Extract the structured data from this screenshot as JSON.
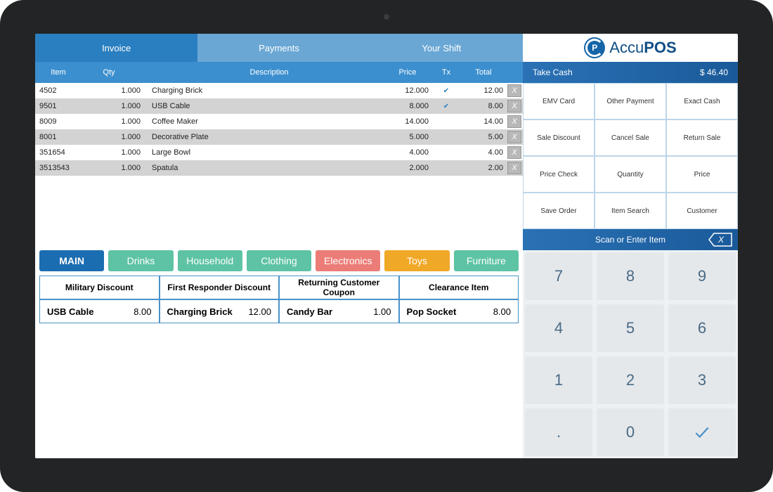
{
  "brand": {
    "logo_letter": "P",
    "name_light": "Accu",
    "name_bold": "POS"
  },
  "tabs": {
    "invoice": "Invoice",
    "payments": "Payments",
    "shift": "Your Shift"
  },
  "headers": {
    "item": "Item",
    "qty": "Qty",
    "desc": "Description",
    "price": "Price",
    "tx": "Tx",
    "total": "Total"
  },
  "rows": [
    {
      "item": "4502",
      "qty": "1.000",
      "desc": "Charging Brick",
      "price": "12.000",
      "tx": true,
      "total": "12.00"
    },
    {
      "item": "9501",
      "qty": "1.000",
      "desc": "USB Cable",
      "price": "8.000",
      "tx": true,
      "total": "8.00"
    },
    {
      "item": "8009",
      "qty": "1.000",
      "desc": "Coffee Maker",
      "price": "14.000",
      "tx": false,
      "total": "14.00"
    },
    {
      "item": "8001",
      "qty": "1.000",
      "desc": "Decorative Plate",
      "price": "5.000",
      "tx": false,
      "total": "5.00"
    },
    {
      "item": "351654",
      "qty": "1.000",
      "desc": "Large Bowl",
      "price": "4.000",
      "tx": false,
      "total": "4.00"
    },
    {
      "item": "3513543",
      "qty": "1.000",
      "desc": "Spatula",
      "price": "2.000",
      "tx": false,
      "total": "2.00"
    }
  ],
  "delete_glyph": "X",
  "categories": {
    "main": "MAIN",
    "c1": "Drinks",
    "c2": "Household",
    "c3": "Clothing",
    "c4": "Electronics",
    "c5": "Toys",
    "c6": "Furniture"
  },
  "discounts": [
    "Military Discount",
    "First Responder Discount",
    "Returning Customer Coupon",
    "Clearance Item"
  ],
  "quick_items": [
    {
      "name": "USB Cable",
      "price": "8.00"
    },
    {
      "name": "Charging Brick",
      "price": "12.00"
    },
    {
      "name": "Candy Bar",
      "price": "1.00"
    },
    {
      "name": "Pop Socket",
      "price": "8.00"
    }
  ],
  "takecash": {
    "label": "Take Cash",
    "amount": "$ 46.40"
  },
  "actions": [
    "EMV Card",
    "Other Payment",
    "Exact Cash",
    "Sale Discount",
    "Cancel Sale",
    "Return Sale",
    "Price Check",
    "Quantity",
    "Price",
    "Save Order",
    "Item Search",
    "Customer"
  ],
  "scan_label": "Scan or Enter Item",
  "keys": [
    "7",
    "8",
    "9",
    "4",
    "5",
    "6",
    "1",
    "2",
    "3",
    ".",
    "0",
    "✓"
  ]
}
